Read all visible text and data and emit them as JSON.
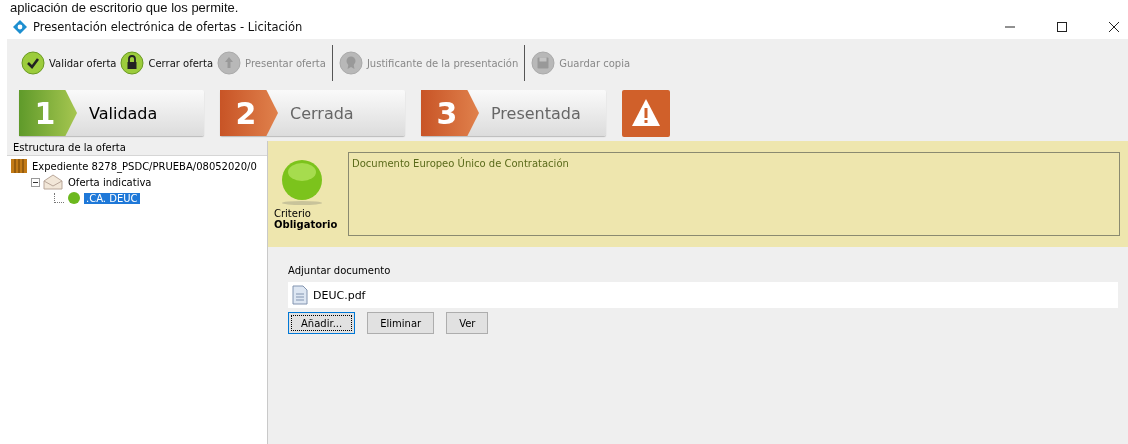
{
  "caption": "aplicación de escritorio que los permite.",
  "window": {
    "title": "Presentación electrónica de ofertas - Licitación"
  },
  "toolbar": [
    {
      "label": "Validar oferta",
      "kind": "check",
      "disabled": false,
      "separator_before": false
    },
    {
      "label": "Cerrar oferta",
      "kind": "lock",
      "disabled": false,
      "separator_before": false
    },
    {
      "label": "Presentar oferta",
      "kind": "upload",
      "disabled": true,
      "separator_before": false
    },
    {
      "label": "Justificante de la presentación",
      "kind": "award",
      "disabled": true,
      "separator_before": true
    },
    {
      "label": "Guardar copia",
      "kind": "save",
      "disabled": true,
      "separator_before": true
    }
  ],
  "steps": [
    {
      "number": "1",
      "label": "Validada",
      "done": true
    },
    {
      "number": "2",
      "label": "Cerrada",
      "done": false
    },
    {
      "number": "3",
      "label": "Presentada",
      "done": false
    }
  ],
  "tree": {
    "title": "Estructura de la oferta",
    "items": [
      {
        "label": "Expediente 8278_PSDC/PRUEBA/08052020/0",
        "kind": "file",
        "selected": false,
        "children": [
          {
            "label": "Oferta indicativa",
            "kind": "envelope",
            "selected": false,
            "expanded": true,
            "children": [
              {
                "label": ".CA. DEUC",
                "kind": "dot",
                "selected": true
              }
            ]
          }
        ]
      }
    ]
  },
  "criterion": {
    "label": "Criterio",
    "type": "Obligatorio",
    "description": "Documento Europeo Único de Contratación"
  },
  "attach": {
    "label": "Adjuntar documento",
    "files": [
      "DEUC.pdf"
    ],
    "buttons": [
      {
        "label": "Añadir...",
        "selected": true
      },
      {
        "label": "Eliminar",
        "selected": false
      },
      {
        "label": "Ver",
        "selected": false
      }
    ]
  }
}
